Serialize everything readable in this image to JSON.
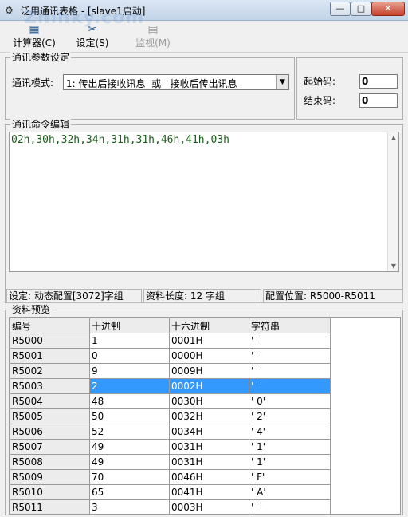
{
  "window": {
    "title": "泛用通讯表格 - [slave1启动]",
    "min_glyph": "—",
    "max_glyph": "□",
    "close_glyph": "✕"
  },
  "watermark": "Zhinky.com",
  "toolbar": {
    "calculator": "计算器(C)",
    "settings": "设定(S)",
    "monitor": "监视(M)",
    "calc_icon": "calculator-icon",
    "settings_icon": "tools-icon",
    "monitor_icon": "monitor-icon"
  },
  "params": {
    "group_label": "通讯参数设定",
    "mode_label": "通讯模式:",
    "mode_value": "1: 传出后接收讯息  或   接收后传出讯息",
    "start_label": "起始码:",
    "start_value": "0",
    "end_label": "结束码:",
    "end_value": "0"
  },
  "editor": {
    "group_label": "通讯命令编辑",
    "content": "02h,30h,32h,34h,31h,31h,46h,41h,03h"
  },
  "status": {
    "setting": "设定: 动态配置[3072]字组",
    "length": "资料长度: 12 字组",
    "location": "配置位置: R5000-R5011"
  },
  "preview": {
    "group_label": "资料预览",
    "headers": [
      "编号",
      "十进制",
      "十六进制",
      "字符串"
    ],
    "selected_row": 3,
    "rows": [
      [
        "R5000",
        "1",
        "0001H",
        "'  '"
      ],
      [
        "R5001",
        "0",
        "0000H",
        "'  '"
      ],
      [
        "R5002",
        "9",
        "0009H",
        "'  '"
      ],
      [
        "R5003",
        "2",
        "0002H",
        "'  '"
      ],
      [
        "R5004",
        "48",
        "0030H",
        "' 0'"
      ],
      [
        "R5005",
        "50",
        "0032H",
        "' 2'"
      ],
      [
        "R5006",
        "52",
        "0034H",
        "' 4'"
      ],
      [
        "R5007",
        "49",
        "0031H",
        "' 1'"
      ],
      [
        "R5008",
        "49",
        "0031H",
        "' 1'"
      ],
      [
        "R5009",
        "70",
        "0046H",
        "' F'"
      ],
      [
        "R5010",
        "65",
        "0041H",
        "' A'"
      ],
      [
        "R5011",
        "3",
        "0003H",
        "'  '"
      ]
    ]
  },
  "colors": {
    "selection": "#3399ff",
    "editor_text": "#1a5d1a"
  }
}
